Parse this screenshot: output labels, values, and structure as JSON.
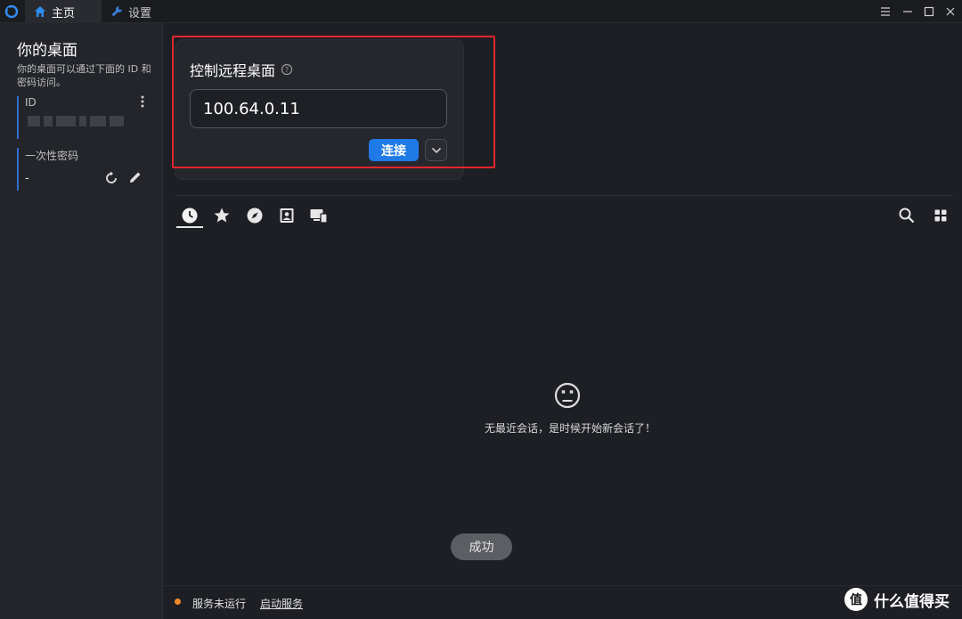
{
  "titlebar": {
    "tabs": [
      {
        "label": "主页",
        "icon": "home-icon"
      },
      {
        "label": "设置",
        "icon": "wrench-icon"
      }
    ],
    "controls": [
      "menu-icon",
      "minimize-icon",
      "maximize-icon",
      "close-icon"
    ]
  },
  "sidebar": {
    "title": "你的桌面",
    "description": "你的桌面可以通过下面的 ID 和密码访问。",
    "id_label": "ID",
    "password_label": "一次性密码",
    "password_value": "-"
  },
  "connect": {
    "title": "控制远程桌面",
    "input_value": "100.64.0.11",
    "connect_label": "连接"
  },
  "peer_tabs": [
    "recent-sessions-icon",
    "favorites-icon",
    "discovered-icon",
    "address-book-icon",
    "group-devices-icon"
  ],
  "empty_state": {
    "message": "无最近会话，是时候开始新会话了！"
  },
  "toast": {
    "text": "成功"
  },
  "status": {
    "service_text": "服务未运行",
    "start_service_label": "启动服务",
    "dot_color": "#f08a2a"
  },
  "watermark": {
    "logo_text": "值",
    "text": "什么值得买"
  },
  "colors": {
    "accent": "#1f7ae8",
    "highlight": "#e0282d"
  }
}
